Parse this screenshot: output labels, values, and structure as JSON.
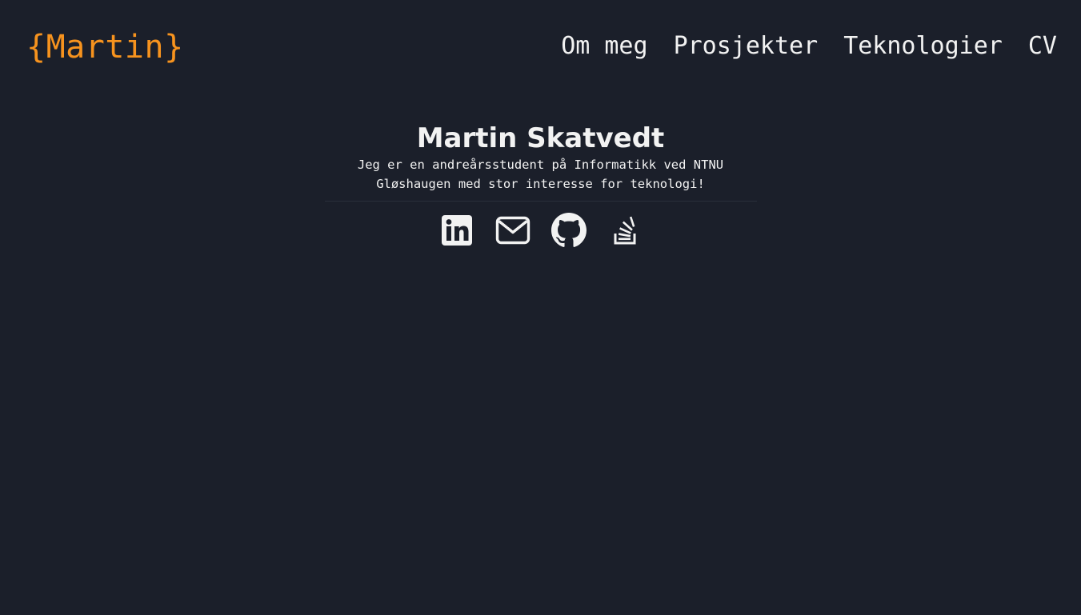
{
  "header": {
    "logo": "{Martin}",
    "nav": [
      {
        "label": "Om meg"
      },
      {
        "label": "Prosjekter"
      },
      {
        "label": "Teknologier"
      },
      {
        "label": "CV"
      }
    ]
  },
  "hero": {
    "name": "Martin Skatvedt",
    "bio": "Jeg er en andreårsstudent på Informatikk ved NTNU Gløshaugen med stor interesse for teknologi!"
  },
  "socials": [
    {
      "icon": "linkedin-icon"
    },
    {
      "icon": "mail-icon"
    },
    {
      "icon": "github-icon"
    },
    {
      "icon": "stackoverflow-icon"
    }
  ],
  "colors": {
    "background": "#1b1f2a",
    "accent": "#f7931e",
    "text": "#f2f2f2"
  }
}
